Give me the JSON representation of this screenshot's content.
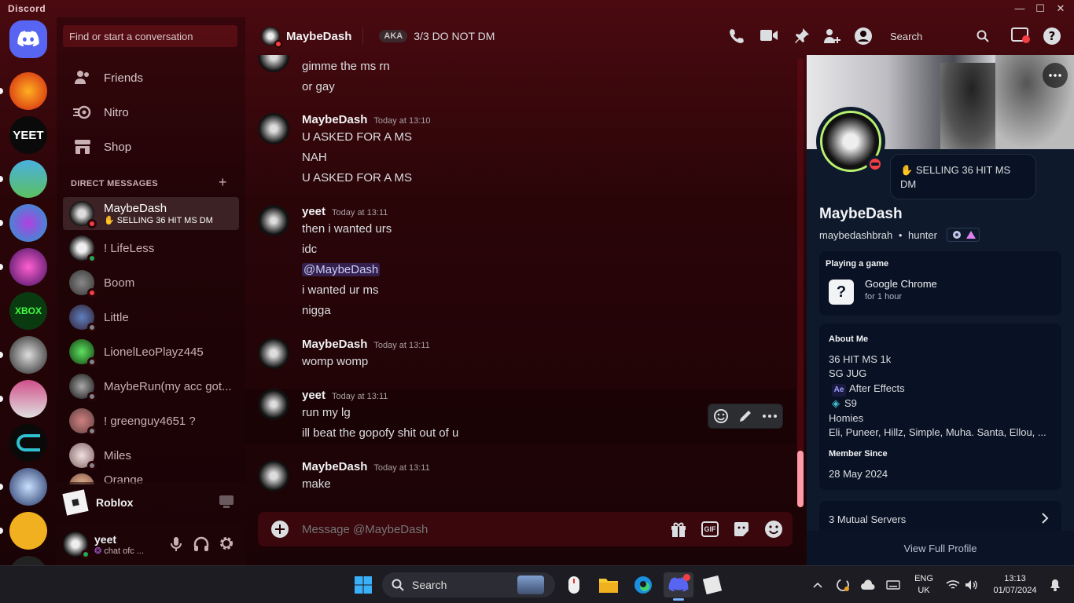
{
  "app": {
    "title": "Discord",
    "accent": "#5865f2"
  },
  "dm_sidebar": {
    "search_placeholder": "Find or start a conversation",
    "nav": [
      {
        "label": "Friends",
        "icon": "friends-icon"
      },
      {
        "label": "Nitro",
        "icon": "nitro-icon"
      },
      {
        "label": "Shop",
        "icon": "shop-icon"
      }
    ],
    "section_header": "DIRECT MESSAGES",
    "dms": [
      {
        "name": "MaybeDash",
        "sub": "SELLING 36 HIT MS DM",
        "status": "dnd",
        "active": true
      },
      {
        "name": "! LifeLess",
        "status": "on"
      },
      {
        "name": "Boom",
        "status": "dnd"
      },
      {
        "name": "Little",
        "status": "off"
      },
      {
        "name": "LionelLeoPlayz445",
        "status": "off"
      },
      {
        "name": "MaybeRun(my acc got...",
        "status": "off"
      },
      {
        "name": "! greenguy4651 ?",
        "status": "off"
      },
      {
        "name": "Miles",
        "status": "off"
      },
      {
        "name": "Orange",
        "status": "off"
      }
    ],
    "activity": {
      "name": "Roblox"
    },
    "user": {
      "name": "yeet",
      "status_text": "chat ofc ..."
    }
  },
  "chat_header": {
    "name": "MaybeDash",
    "aka_label": "AKA",
    "aka_value": "3/3 DO NOT DM",
    "search_placeholder": "Search"
  },
  "messages": [
    {
      "author": null,
      "lines": [
        "gimme the ms rn",
        "or gay"
      ]
    },
    {
      "author": "MaybeDash",
      "time": "Today at 13:10",
      "lines": [
        "U ASKED FOR A MS",
        "NAH",
        "U ASKED FOR A MS"
      ]
    },
    {
      "author": "yeet",
      "time": "Today at 13:11",
      "lines": [
        "then i wanted urs",
        "idc",
        "@MaybeDash",
        "i wanted ur ms",
        "nigga"
      ]
    },
    {
      "author": "MaybeDash",
      "time": "Today at 13:11",
      "lines": [
        "womp womp"
      ]
    },
    {
      "author": "yeet",
      "time": "Today at 13:11",
      "lines": [
        "run my lg",
        "ill beat the gopofy shit out of u"
      ]
    },
    {
      "author": "MaybeDash",
      "time": "Today at 13:11",
      "lines": [
        "make"
      ]
    }
  ],
  "composer": {
    "placeholder": "Message @MaybeDash",
    "gif_label": "GIF"
  },
  "profile": {
    "custom_status": "SELLING 36 HIT MS DM",
    "display_name": "MaybeDash",
    "username": "maybedashbrah",
    "pronouns": "hunter",
    "playing": {
      "header": "Playing a game",
      "game": "Google Chrome",
      "duration": "for 1 hour"
    },
    "about": {
      "header": "About Me",
      "lines": [
        "36 HIT MS 1k",
        "SG JUG",
        "After Effects",
        "S9",
        "Homies",
        "Eli, Puneer, Hillz, Simple, Muha. Santa, Ellou, ..."
      ],
      "ae_badge": "Ae"
    },
    "member_since": {
      "header": "Member Since",
      "date": "28 May 2024"
    },
    "mutual": "3 Mutual Servers",
    "full_profile": "View Full Profile"
  },
  "taskbar": {
    "search_label": "Search",
    "lang": "ENG",
    "region": "UK",
    "time": "13:13",
    "date": "01/07/2024"
  }
}
